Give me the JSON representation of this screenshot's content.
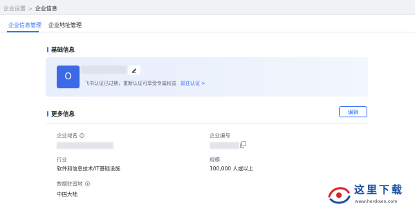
{
  "breadcrumb": {
    "parent": "企业设置",
    "current": "企业信息"
  },
  "tabs": [
    {
      "label": "企业信息管理",
      "active": true
    },
    {
      "label": "企业地址管理",
      "active": false
    }
  ],
  "basic_info": {
    "title": "基础信息",
    "avatar_letter": "O",
    "notice": "飞书认证已过期，重新认证可享受专属权益",
    "reauth_link": "前往认证",
    "edit_icon": "pencil-icon"
  },
  "more_info": {
    "title": "更多信息",
    "edit_button": "编辑",
    "fields": {
      "domain_label": "企业域名",
      "number_label": "企业编号",
      "industry_label": "行业",
      "industry_value": "软件和信息技术/IT基础设施",
      "scale_label": "规模",
      "scale_value": "100,000 人或以上",
      "region_label": "数据驻留地",
      "region_value": "中国大陆"
    }
  },
  "watermark": {
    "title": "这里下载",
    "url": "www.herdown.com"
  },
  "colors": {
    "accent": "#3370ff",
    "avatar": "#3c6ae6",
    "watermark_text": "#1a4fa6",
    "watermark_logo_red": "#d8232a"
  }
}
